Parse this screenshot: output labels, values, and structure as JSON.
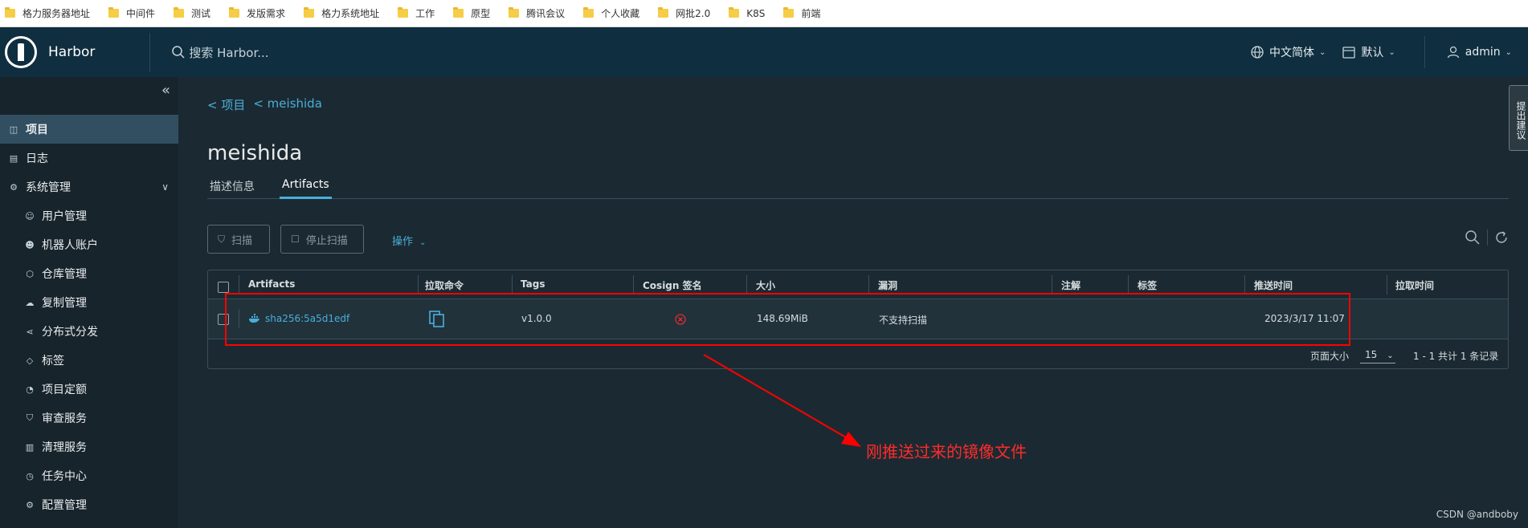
{
  "bookmarks": [
    "格力服务器地址",
    "中间件",
    "测试",
    "发版需求",
    "格力系统地址",
    "工作",
    "原型",
    "腾讯会议",
    "个人收藏",
    "网批2.0",
    "K8S",
    "前端"
  ],
  "header": {
    "brand": "Harbor",
    "search_placeholder": "搜索 Harbor...",
    "language": "中文简体",
    "theme": "默认",
    "user": "admin"
  },
  "sidebar": {
    "items": [
      {
        "label": "项目",
        "icon": "projects-icon",
        "active": true
      },
      {
        "label": "日志",
        "icon": "logs-icon"
      },
      {
        "label": "系统管理",
        "icon": "admin-icon",
        "expandable": true
      }
    ],
    "sub_items": [
      {
        "label": "用户管理",
        "icon": "users-icon"
      },
      {
        "label": "机器人账户",
        "icon": "robot-icon"
      },
      {
        "label": "仓库管理",
        "icon": "registry-icon"
      },
      {
        "label": "复制管理",
        "icon": "replication-icon"
      },
      {
        "label": "分布式分发",
        "icon": "distribution-icon"
      },
      {
        "label": "标签",
        "icon": "tag-icon"
      },
      {
        "label": "项目定额",
        "icon": "quota-icon"
      },
      {
        "label": "审查服务",
        "icon": "shield-icon"
      },
      {
        "label": "清理服务",
        "icon": "trash-icon"
      },
      {
        "label": "任务中心",
        "icon": "clock-icon"
      },
      {
        "label": "配置管理",
        "icon": "gear-icon"
      }
    ]
  },
  "main": {
    "breadcrumb": [
      "< 项目",
      "< meishida"
    ],
    "title": "meishida",
    "tabs": [
      "描述信息",
      "Artifacts"
    ],
    "active_tab": "Artifacts",
    "toolbar": {
      "scan": "扫描",
      "stop_scan": "停止扫描",
      "actions": "操作"
    },
    "table": {
      "columns": [
        "Artifacts",
        "拉取命令",
        "Tags",
        "Cosign 签名",
        "大小",
        "漏洞",
        "注解",
        "标签",
        "推送时间",
        "拉取时间"
      ],
      "rows": [
        {
          "artifact": "sha256:5a5d1edf",
          "tags": "v1.0.0",
          "size": "148.69MiB",
          "vulnerability": "不支持扫描",
          "push_time": "2023/3/17 11:07"
        }
      ],
      "page_size_label": "页面大小",
      "page_size": "15",
      "summary": "1 - 1 共计 1 条记录"
    }
  },
  "annotation": "刚推送过来的镜像文件",
  "feedback": "提出建议",
  "watermark": "CSDN @andboby",
  "colors": {
    "header": "#0f2e3f",
    "accent": "#4aaed9",
    "annotation": "#ff0000"
  }
}
